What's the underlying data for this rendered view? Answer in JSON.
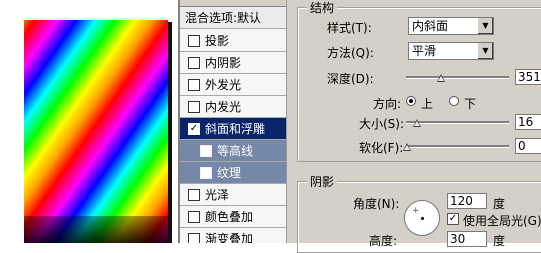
{
  "styles_list": {
    "header": "混合选项:默认",
    "items": [
      {
        "label": "投影",
        "checked": false
      },
      {
        "label": "内阴影",
        "checked": false
      },
      {
        "label": "外发光",
        "checked": false
      },
      {
        "label": "内发光",
        "checked": false
      },
      {
        "label": "斜面和浮雕",
        "checked": true,
        "selected": true
      },
      {
        "label": "等高线",
        "checked": false,
        "sub": true
      },
      {
        "label": "纹理",
        "checked": false,
        "sub": true
      },
      {
        "label": "光泽",
        "checked": false
      },
      {
        "label": "颜色叠加",
        "checked": false
      },
      {
        "label": "渐变叠加",
        "checked": false
      }
    ]
  },
  "structure": {
    "title": "结构",
    "style_label": "样式(T):",
    "style_value": "内斜面",
    "technique_label": "方法(Q):",
    "technique_value": "平滑",
    "depth_label": "深度(D):",
    "depth_value": "351",
    "direction_label": "方向:",
    "direction_up": "上",
    "direction_down": "下",
    "direction_selected": "上",
    "size_label": "大小(S):",
    "size_value": "16",
    "soften_label": "软化(F):",
    "soften_value": "0"
  },
  "shading": {
    "title": "阴影",
    "angle_label": "角度(N):",
    "angle_value": "120",
    "angle_unit": "度",
    "global_light_label": "使用全局光(G)",
    "global_light_checked": true,
    "altitude_label": "高度:",
    "altitude_value": "30",
    "altitude_unit": "度"
  },
  "icons": {
    "check": "✓",
    "dropdown": "▼",
    "crosshair": "+"
  }
}
